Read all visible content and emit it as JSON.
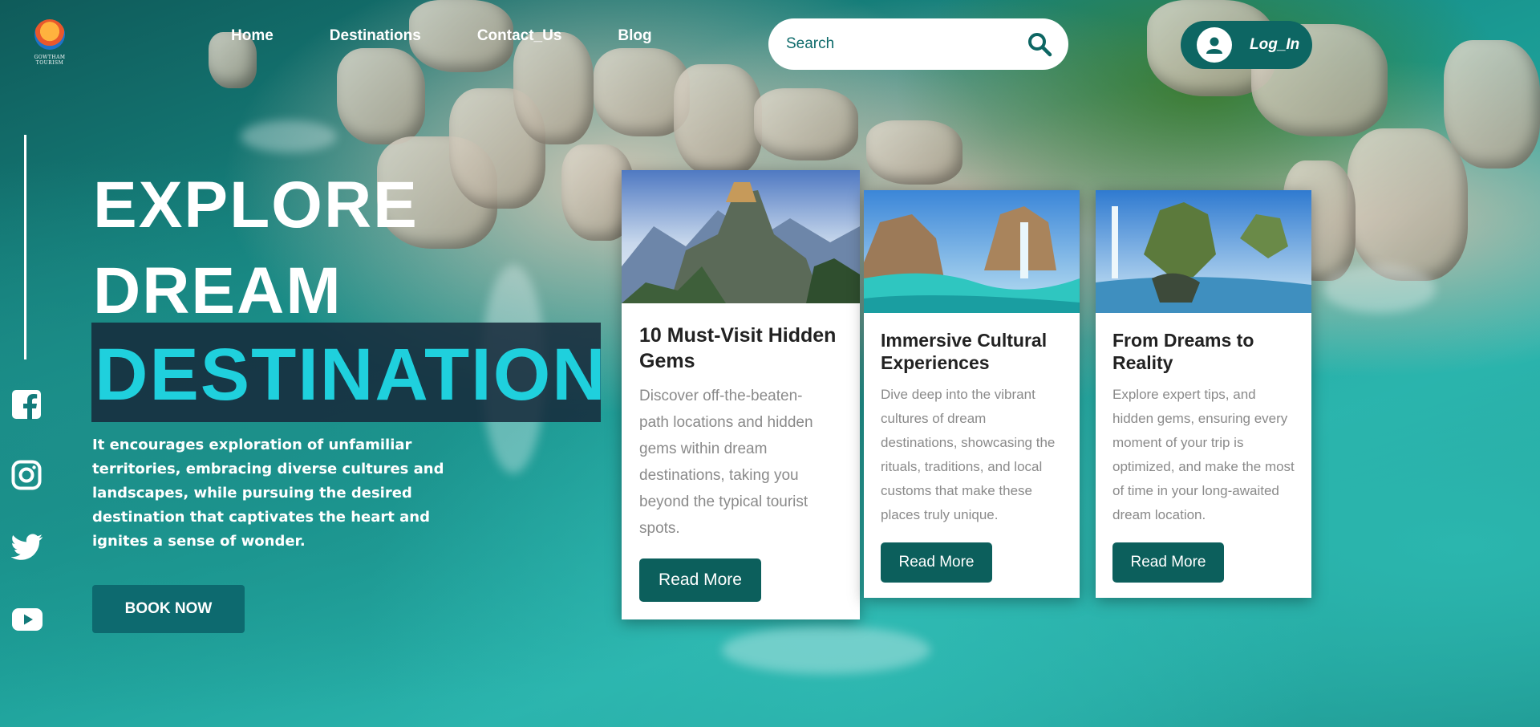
{
  "brand": {
    "logo_text": "GOWTHAM TOURISM"
  },
  "nav": {
    "items": [
      {
        "label": "Home"
      },
      {
        "label": "Destinations"
      },
      {
        "label": "Contact_Us"
      },
      {
        "label": "Blog"
      }
    ]
  },
  "search": {
    "placeholder": "Search",
    "icon": "search-icon"
  },
  "login": {
    "label": "Log_In",
    "icon": "user-icon"
  },
  "social": [
    {
      "icon": "facebook-icon"
    },
    {
      "icon": "instagram-icon"
    },
    {
      "icon": "twitter-icon"
    },
    {
      "icon": "youtube-icon"
    }
  ],
  "hero": {
    "line1": "EXPLORE",
    "line2": "DREAM",
    "accent": "DESTINATION",
    "description": "It encourages exploration of unfamiliar territories, embracing diverse cultures and landscapes, while pursuing the desired destination that captivates the heart and ignites a sense of wonder.",
    "cta": "BOOK NOW"
  },
  "cards": [
    {
      "title": "10 Must-Visit Hidden Gems",
      "text": "Discover off-the-beaten-path locations and hidden gems within dream destinations, taking you beyond the typical tourist spots.",
      "button": "Read More"
    },
    {
      "title": "Immersive Cultural Experiences",
      "text": "Dive deep into the vibrant cultures of dream destinations, showcasing the rituals, traditions, and local customs that make these places truly unique.",
      "button": "Read More"
    },
    {
      "title": "From Dreams to Reality",
      "text": "Explore expert tips, and hidden gems, ensuring every moment of your trip is optimized, and make the most of time in your long-awaited dream location.",
      "button": "Read More"
    }
  ],
  "colors": {
    "accent": "#1fd0dd",
    "primary": "#0d6663",
    "button": "#0c5f5c",
    "hero_band": "#16283a"
  }
}
